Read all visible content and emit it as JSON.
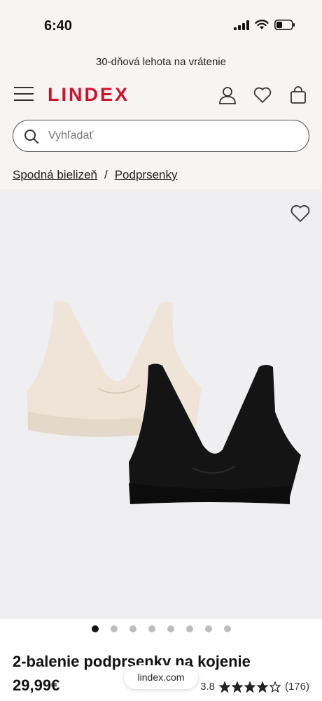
{
  "status": {
    "time": "6:40"
  },
  "promo": {
    "text": "30-dňová lehota na vrátenie"
  },
  "header": {
    "logo": "LINDEX"
  },
  "search": {
    "placeholder": "Vyhľadať"
  },
  "breadcrumb": {
    "items": [
      "Spodná bielizeň",
      "Podprsenky"
    ],
    "separator": "/"
  },
  "gallery": {
    "image_count": 8,
    "active_index": 0
  },
  "product": {
    "title": "2-balenie podprsenky na kojenie",
    "price": "29,99€",
    "rating": "3.8",
    "rating_stars": 3.8,
    "reviews": "(176)"
  },
  "browser": {
    "url": "lindex.com"
  },
  "colors": {
    "brand": "#d0102a",
    "background": "#f7f5f2",
    "image_bg": "#efeff1"
  }
}
